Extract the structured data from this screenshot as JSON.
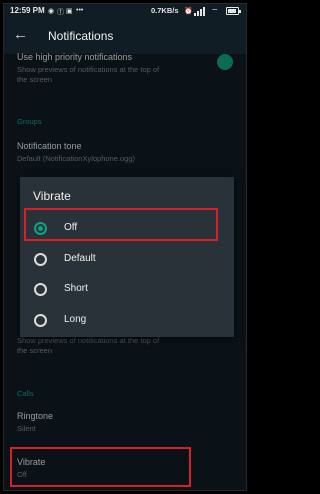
{
  "status_bar": {
    "time": "12:59 PM",
    "speed": "0.7KB/s",
    "icons": [
      "whatsapp-icon",
      "facebook-icon",
      "gallery-icon",
      "more-dots-icon",
      "alarm-icon",
      "signal-icon",
      "wifi-icon",
      "battery-icon"
    ]
  },
  "app_bar": {
    "title": "Notifications",
    "back_icon": "arrow-back-icon"
  },
  "settings": {
    "high_priority": {
      "title": "Use high priority notifications",
      "subtitle_1": "Show previews of notifications at the top of",
      "subtitle_2": "the screen",
      "toggle_on": true
    },
    "groups_header": "Groups",
    "notification_tone": {
      "title": "Notification tone",
      "value": "Default (NotificationXylophone.ogg)"
    },
    "groups_priority": {
      "subtitle_1": "Show previews of notifications at the top of",
      "subtitle_2": "the screen"
    },
    "calls_header": "Calls",
    "ringtone": {
      "title": "Ringtone",
      "value": "Silent"
    },
    "vibrate": {
      "title": "Vibrate",
      "value": "Off"
    }
  },
  "dialog": {
    "title": "Vibrate",
    "options": [
      {
        "label": "Off",
        "selected": true
      },
      {
        "label": "Default",
        "selected": false
      },
      {
        "label": "Short",
        "selected": false
      },
      {
        "label": "Long",
        "selected": false
      }
    ]
  },
  "colors": {
    "background": "#101d25",
    "dialog": "#283238",
    "accent": "#10a084",
    "highlight": "#d9202a"
  }
}
